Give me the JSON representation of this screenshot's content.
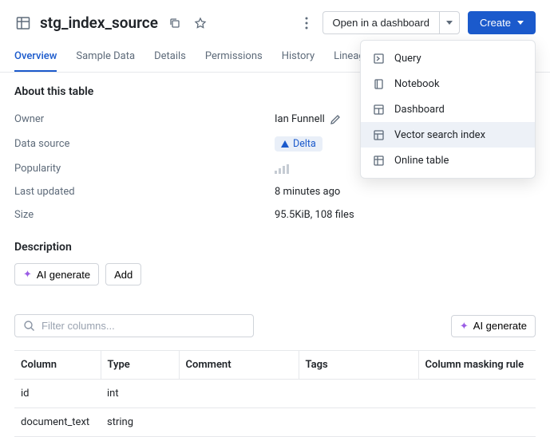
{
  "header": {
    "title": "stg_index_source",
    "open_label": "Open in a dashboard",
    "create_label": "Create"
  },
  "tabs": [
    "Overview",
    "Sample Data",
    "Details",
    "Permissions",
    "History",
    "Lineage"
  ],
  "about": {
    "section_title": "About this table",
    "rows": {
      "owner": {
        "label": "Owner",
        "value": "Ian Funnell"
      },
      "data_source": {
        "label": "Data source",
        "value": "Delta"
      },
      "popularity": {
        "label": "Popularity"
      },
      "last_updated": {
        "label": "Last updated",
        "value": "8 minutes ago"
      },
      "size": {
        "label": "Size",
        "value": "95.5KiB, 108 files"
      }
    }
  },
  "description": {
    "title": "Description",
    "ai_generate": "AI generate",
    "add": "Add"
  },
  "columns_panel": {
    "filter_placeholder": "Filter columns...",
    "ai_generate": "AI generate",
    "headers": {
      "column": "Column",
      "type": "Type",
      "comment": "Comment",
      "tags": "Tags",
      "masking": "Column masking rule"
    },
    "rows": [
      {
        "column": "id",
        "type": "int"
      },
      {
        "column": "document_text",
        "type": "string"
      }
    ]
  },
  "dropdown": {
    "items": [
      {
        "label": "Query"
      },
      {
        "label": "Notebook"
      },
      {
        "label": "Dashboard"
      },
      {
        "label": "Vector search index"
      },
      {
        "label": "Online table"
      }
    ]
  }
}
